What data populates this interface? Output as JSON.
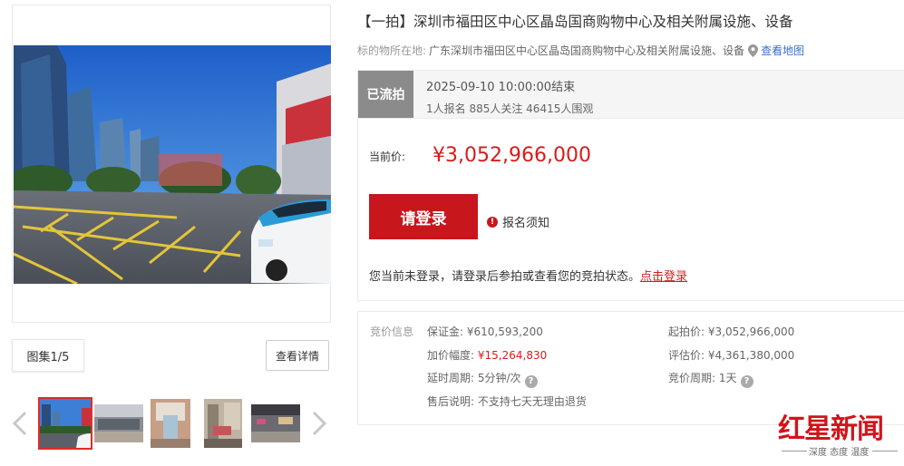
{
  "gallery": {
    "album_label": "图集1/5",
    "detail_button": "查看详情",
    "prev_icon": "chevron-left-icon",
    "next_icon": "chevron-right-icon"
  },
  "header": {
    "title": "【一拍】深圳市福田区中心区晶岛国商购物中心及相关附属设施、设备",
    "location_label": "标的物所在地:",
    "location_value": "广东深圳市福田区中心区晶岛国商购物中心及相关附属设施、设备",
    "map_link": "查看地图"
  },
  "status": {
    "badge": "已流拍",
    "end_time": "2025-09-10 10:00:00结束",
    "stats": "1人报名  885人关注  46415人围观"
  },
  "bid": {
    "price_label": "当前价:",
    "price_value": "¥3,052,966,000",
    "login_button": "请登录",
    "notice_label": "报名须知",
    "login_message": "您当前未登录，请登录后参拍或查看您的竞拍状态。",
    "login_link": "点击登录"
  },
  "info": {
    "heading": "竞价信息",
    "deposit_label": "保证金:",
    "deposit_value": "¥610,593,200",
    "start_label": "起拍价:",
    "start_value": "¥3,052,966,000",
    "increment_label": "加价幅度:",
    "increment_value": "¥15,264,830",
    "appraisal_label": "评估价:",
    "appraisal_value": "¥4,361,380,000",
    "delay_label": "延时周期:",
    "delay_value": "5分钟/次",
    "cycle_label": "竞价周期:",
    "cycle_value": "1天",
    "aftersale_label": "售后说明:",
    "aftersale_value": "不支持七天无理由退货"
  },
  "watermark": {
    "brand": "红星新闻",
    "slogan": "深度 态度 温度"
  },
  "colors": {
    "accent_red": "#c8161d",
    "price_red": "#d71c1c",
    "badge_gray": "#8b8b8b",
    "link_blue": "#3a6fc7"
  }
}
